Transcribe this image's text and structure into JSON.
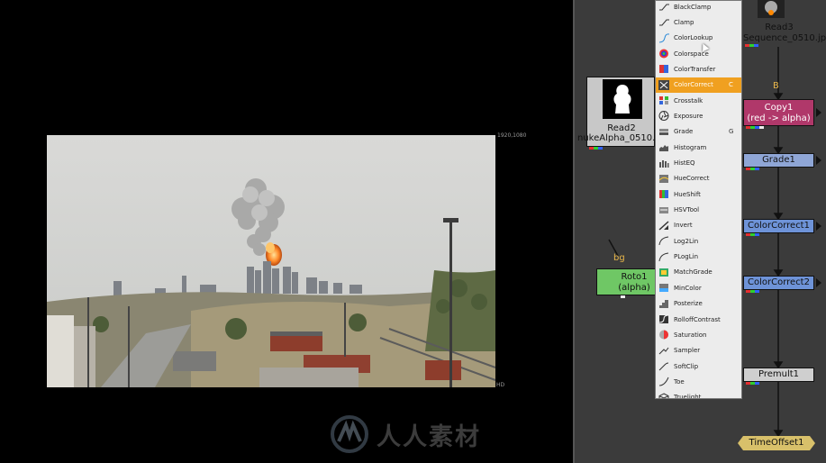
{
  "viewer": {
    "resolution_label": "1920,1080",
    "format_label": "HD",
    "watermark_text": "人人素材"
  },
  "nodes": {
    "read3": {
      "label": "Read3",
      "sublabel": "Sequence_0510.jp"
    },
    "read2": {
      "label": "Read2",
      "sublabel": "nukeAlpha_0510."
    },
    "copy1": {
      "label": "Copy1",
      "sublabel": "(red -> alpha)"
    },
    "grade1": {
      "label": "Grade1"
    },
    "colorcorrect1": {
      "label": "ColorCorrect1"
    },
    "colorcorrect2": {
      "label": "ColorCorrect2"
    },
    "premult1": {
      "label": "Premult1"
    },
    "timeoffset1": {
      "label": "TimeOffset1"
    },
    "roto1": {
      "label": "Roto1",
      "sublabel": "(alpha)"
    }
  },
  "pins": {
    "b": "B",
    "bg": "bg"
  },
  "menu": {
    "items": [
      {
        "label": "BlackClamp",
        "icon": "clamp-icon",
        "shortcut": ""
      },
      {
        "label": "Clamp",
        "icon": "clamp-icon",
        "shortcut": ""
      },
      {
        "label": "ColorLookup",
        "icon": "curve-icon",
        "shortcut": ""
      },
      {
        "label": "Colorspace",
        "icon": "colorspace-icon",
        "shortcut": ""
      },
      {
        "label": "ColorTransfer",
        "icon": "transfer-icon",
        "shortcut": ""
      },
      {
        "label": "ColorCorrect",
        "icon": "colorcorrect-icon",
        "shortcut": "C",
        "highlighted": true
      },
      {
        "label": "Crosstalk",
        "icon": "crosstalk-icon",
        "shortcut": ""
      },
      {
        "label": "Exposure",
        "icon": "aperture-icon",
        "shortcut": ""
      },
      {
        "label": "Grade",
        "icon": "grade-icon",
        "shortcut": "G"
      },
      {
        "label": "Histogram",
        "icon": "histogram-icon",
        "shortcut": ""
      },
      {
        "label": "HistEQ",
        "icon": "histeq-icon",
        "shortcut": ""
      },
      {
        "label": "HueCorrect",
        "icon": "huecorrect-icon",
        "shortcut": ""
      },
      {
        "label": "HueShift",
        "icon": "hueshift-icon",
        "shortcut": ""
      },
      {
        "label": "HSVTool",
        "icon": "hsv-icon",
        "shortcut": ""
      },
      {
        "label": "Invert",
        "icon": "invert-icon",
        "shortcut": ""
      },
      {
        "label": "Log2Lin",
        "icon": "log-icon",
        "shortcut": ""
      },
      {
        "label": "PLogLin",
        "icon": "log-icon",
        "shortcut": ""
      },
      {
        "label": "MatchGrade",
        "icon": "matchgrade-icon",
        "shortcut": ""
      },
      {
        "label": "MinColor",
        "icon": "mincolor-icon",
        "shortcut": ""
      },
      {
        "label": "Posterize",
        "icon": "posterize-icon",
        "shortcut": ""
      },
      {
        "label": "RolloffContrast",
        "icon": "rolloff-icon",
        "shortcut": ""
      },
      {
        "label": "Saturation",
        "icon": "saturation-icon",
        "shortcut": ""
      },
      {
        "label": "Sampler",
        "icon": "sampler-icon",
        "shortcut": ""
      },
      {
        "label": "SoftClip",
        "icon": "softclip-icon",
        "shortcut": ""
      },
      {
        "label": "Toe",
        "icon": "toe-icon",
        "shortcut": ""
      },
      {
        "label": "Truelight",
        "icon": "cube-icon",
        "shortcut": ""
      }
    ]
  },
  "colors": {
    "graph_bg": "#3b3b3b",
    "menu_bg": "#ececec",
    "menu_highlight": "#f0a020",
    "copy_node": "#b0386a",
    "colorcorrect_node": "#6e93d8",
    "grade_node": "#8fa6d6",
    "roto_node": "#6fc765",
    "timeoffset_node": "#d8c06a",
    "pin_text": "#e8b64a"
  }
}
